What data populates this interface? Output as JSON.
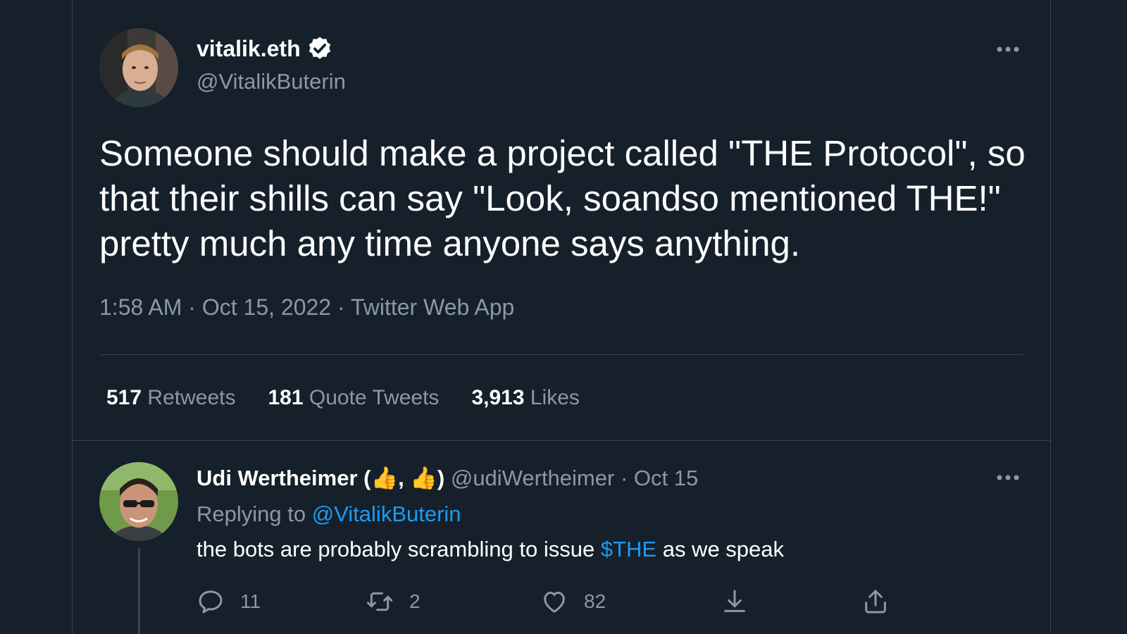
{
  "tweet": {
    "display_name": "vitalik.eth",
    "handle": "@VitalikButerin",
    "text": "Someone should make a project called \"THE Protocol\", so that their shills can say \"Look, soandso mentioned THE!\" pretty much any time anyone says anything.",
    "time": "1:58 AM",
    "separator": "·",
    "date": "Oct 15, 2022",
    "source": "Twitter Web App",
    "stats": {
      "retweets_count": "517",
      "retweets_label": "Retweets",
      "quotes_count": "181",
      "quotes_label": "Quote Tweets",
      "likes_count": "3,913",
      "likes_label": "Likes"
    }
  },
  "reply": {
    "display_name": "Udi Wertheimer (👍, 👍)",
    "handle": "@udiWertheimer",
    "separator": "·",
    "date": "Oct 15",
    "replying_prefix": "Replying to",
    "replying_handle": "@VitalikButerin",
    "text_before": "the bots are probably scrambling to issue",
    "cashtag": "$THE",
    "text_after": "as we speak",
    "actions": {
      "reply_count": "11",
      "retweet_count": "2",
      "like_count": "82"
    }
  },
  "colors": {
    "background": "#15202b",
    "border": "#38444d",
    "secondary_text": "#8b98a5",
    "accent": "#1d9bf0"
  },
  "icons": [
    "verified-icon",
    "more-icon",
    "reply-icon",
    "retweet-icon",
    "like-icon",
    "save-icon",
    "share-icon"
  ]
}
